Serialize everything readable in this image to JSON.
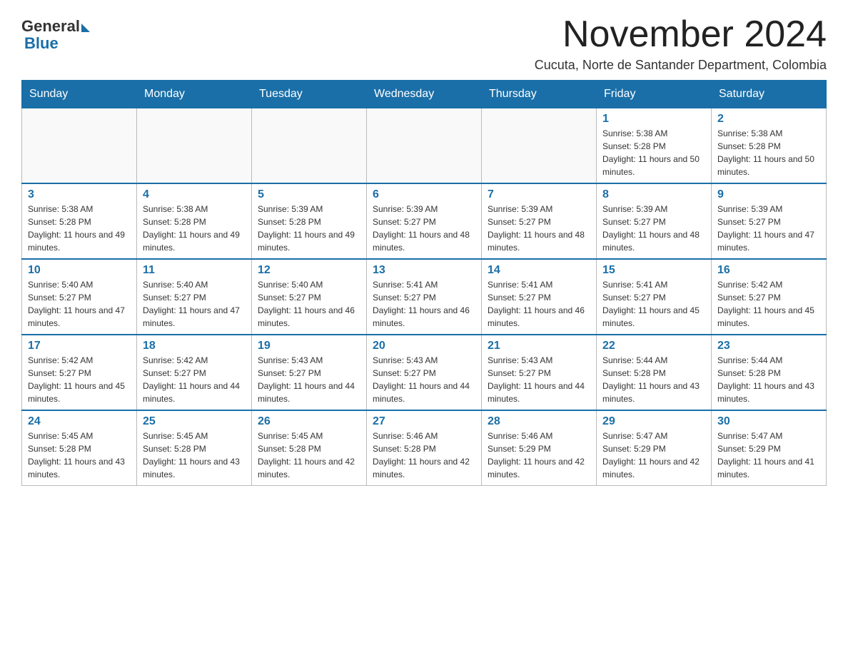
{
  "logo": {
    "general": "General",
    "blue": "Blue"
  },
  "header": {
    "month_year": "November 2024",
    "location": "Cucuta, Norte de Santander Department, Colombia"
  },
  "days_of_week": [
    "Sunday",
    "Monday",
    "Tuesday",
    "Wednesday",
    "Thursday",
    "Friday",
    "Saturday"
  ],
  "weeks": [
    [
      {
        "day": "",
        "info": ""
      },
      {
        "day": "",
        "info": ""
      },
      {
        "day": "",
        "info": ""
      },
      {
        "day": "",
        "info": ""
      },
      {
        "day": "",
        "info": ""
      },
      {
        "day": "1",
        "info": "Sunrise: 5:38 AM\nSunset: 5:28 PM\nDaylight: 11 hours and 50 minutes."
      },
      {
        "day": "2",
        "info": "Sunrise: 5:38 AM\nSunset: 5:28 PM\nDaylight: 11 hours and 50 minutes."
      }
    ],
    [
      {
        "day": "3",
        "info": "Sunrise: 5:38 AM\nSunset: 5:28 PM\nDaylight: 11 hours and 49 minutes."
      },
      {
        "day": "4",
        "info": "Sunrise: 5:38 AM\nSunset: 5:28 PM\nDaylight: 11 hours and 49 minutes."
      },
      {
        "day": "5",
        "info": "Sunrise: 5:39 AM\nSunset: 5:28 PM\nDaylight: 11 hours and 49 minutes."
      },
      {
        "day": "6",
        "info": "Sunrise: 5:39 AM\nSunset: 5:27 PM\nDaylight: 11 hours and 48 minutes."
      },
      {
        "day": "7",
        "info": "Sunrise: 5:39 AM\nSunset: 5:27 PM\nDaylight: 11 hours and 48 minutes."
      },
      {
        "day": "8",
        "info": "Sunrise: 5:39 AM\nSunset: 5:27 PM\nDaylight: 11 hours and 48 minutes."
      },
      {
        "day": "9",
        "info": "Sunrise: 5:39 AM\nSunset: 5:27 PM\nDaylight: 11 hours and 47 minutes."
      }
    ],
    [
      {
        "day": "10",
        "info": "Sunrise: 5:40 AM\nSunset: 5:27 PM\nDaylight: 11 hours and 47 minutes."
      },
      {
        "day": "11",
        "info": "Sunrise: 5:40 AM\nSunset: 5:27 PM\nDaylight: 11 hours and 47 minutes."
      },
      {
        "day": "12",
        "info": "Sunrise: 5:40 AM\nSunset: 5:27 PM\nDaylight: 11 hours and 46 minutes."
      },
      {
        "day": "13",
        "info": "Sunrise: 5:41 AM\nSunset: 5:27 PM\nDaylight: 11 hours and 46 minutes."
      },
      {
        "day": "14",
        "info": "Sunrise: 5:41 AM\nSunset: 5:27 PM\nDaylight: 11 hours and 46 minutes."
      },
      {
        "day": "15",
        "info": "Sunrise: 5:41 AM\nSunset: 5:27 PM\nDaylight: 11 hours and 45 minutes."
      },
      {
        "day": "16",
        "info": "Sunrise: 5:42 AM\nSunset: 5:27 PM\nDaylight: 11 hours and 45 minutes."
      }
    ],
    [
      {
        "day": "17",
        "info": "Sunrise: 5:42 AM\nSunset: 5:27 PM\nDaylight: 11 hours and 45 minutes."
      },
      {
        "day": "18",
        "info": "Sunrise: 5:42 AM\nSunset: 5:27 PM\nDaylight: 11 hours and 44 minutes."
      },
      {
        "day": "19",
        "info": "Sunrise: 5:43 AM\nSunset: 5:27 PM\nDaylight: 11 hours and 44 minutes."
      },
      {
        "day": "20",
        "info": "Sunrise: 5:43 AM\nSunset: 5:27 PM\nDaylight: 11 hours and 44 minutes."
      },
      {
        "day": "21",
        "info": "Sunrise: 5:43 AM\nSunset: 5:27 PM\nDaylight: 11 hours and 44 minutes."
      },
      {
        "day": "22",
        "info": "Sunrise: 5:44 AM\nSunset: 5:28 PM\nDaylight: 11 hours and 43 minutes."
      },
      {
        "day": "23",
        "info": "Sunrise: 5:44 AM\nSunset: 5:28 PM\nDaylight: 11 hours and 43 minutes."
      }
    ],
    [
      {
        "day": "24",
        "info": "Sunrise: 5:45 AM\nSunset: 5:28 PM\nDaylight: 11 hours and 43 minutes."
      },
      {
        "day": "25",
        "info": "Sunrise: 5:45 AM\nSunset: 5:28 PM\nDaylight: 11 hours and 43 minutes."
      },
      {
        "day": "26",
        "info": "Sunrise: 5:45 AM\nSunset: 5:28 PM\nDaylight: 11 hours and 42 minutes."
      },
      {
        "day": "27",
        "info": "Sunrise: 5:46 AM\nSunset: 5:28 PM\nDaylight: 11 hours and 42 minutes."
      },
      {
        "day": "28",
        "info": "Sunrise: 5:46 AM\nSunset: 5:29 PM\nDaylight: 11 hours and 42 minutes."
      },
      {
        "day": "29",
        "info": "Sunrise: 5:47 AM\nSunset: 5:29 PM\nDaylight: 11 hours and 42 minutes."
      },
      {
        "day": "30",
        "info": "Sunrise: 5:47 AM\nSunset: 5:29 PM\nDaylight: 11 hours and 41 minutes."
      }
    ]
  ]
}
